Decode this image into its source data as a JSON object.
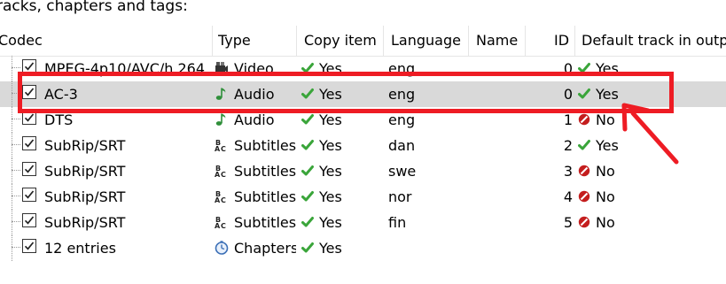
{
  "section_label": "racks, chapters and tags:",
  "columns": {
    "codec": "Codec",
    "type": "Type",
    "copy_item": "Copy item",
    "language": "Language",
    "name": "Name",
    "id": "ID",
    "default_track": "Default track in outp"
  },
  "rows": [
    {
      "codec": "MPEG-4p10/AVC/h.264",
      "type": "Video",
      "type_icon": "film-icon",
      "copy": "Yes",
      "language": "eng",
      "name": "",
      "id": "0",
      "default": "Yes",
      "default_status": "yes"
    },
    {
      "codec": "AC-3",
      "type": "Audio",
      "type_icon": "music-note-icon",
      "copy": "Yes",
      "language": "eng",
      "name": "",
      "id": "0",
      "default": "Yes",
      "default_status": "yes"
    },
    {
      "codec": "DTS",
      "type": "Audio",
      "type_icon": "music-note-icon",
      "copy": "Yes",
      "language": "eng",
      "name": "",
      "id": "1",
      "default": "No",
      "default_status": "no"
    },
    {
      "codec": "SubRip/SRT",
      "type": "Subtitles",
      "type_icon": "subtitles-icon",
      "copy": "Yes",
      "language": "dan",
      "name": "",
      "id": "2",
      "default": "Yes",
      "default_status": "yes"
    },
    {
      "codec": "SubRip/SRT",
      "type": "Subtitles",
      "type_icon": "subtitles-icon",
      "copy": "Yes",
      "language": "swe",
      "name": "",
      "id": "3",
      "default": "No",
      "default_status": "no"
    },
    {
      "codec": "SubRip/SRT",
      "type": "Subtitles",
      "type_icon": "subtitles-icon",
      "copy": "Yes",
      "language": "nor",
      "name": "",
      "id": "4",
      "default": "No",
      "default_status": "no"
    },
    {
      "codec": "SubRip/SRT",
      "type": "Subtitles",
      "type_icon": "subtitles-icon",
      "copy": "Yes",
      "language": "fin",
      "name": "",
      "id": "5",
      "default": "No",
      "default_status": "no"
    },
    {
      "codec": "12 entries",
      "type": "Chapters",
      "type_icon": "clock-icon",
      "copy": "Yes",
      "language": "",
      "name": "",
      "id": "",
      "default": "",
      "default_status": ""
    }
  ],
  "colors": {
    "highlight": "#ee1c24",
    "selected_row": "#d9d9d9",
    "yes_check": "#3aa53a",
    "no_icon": "#c41e1e"
  }
}
